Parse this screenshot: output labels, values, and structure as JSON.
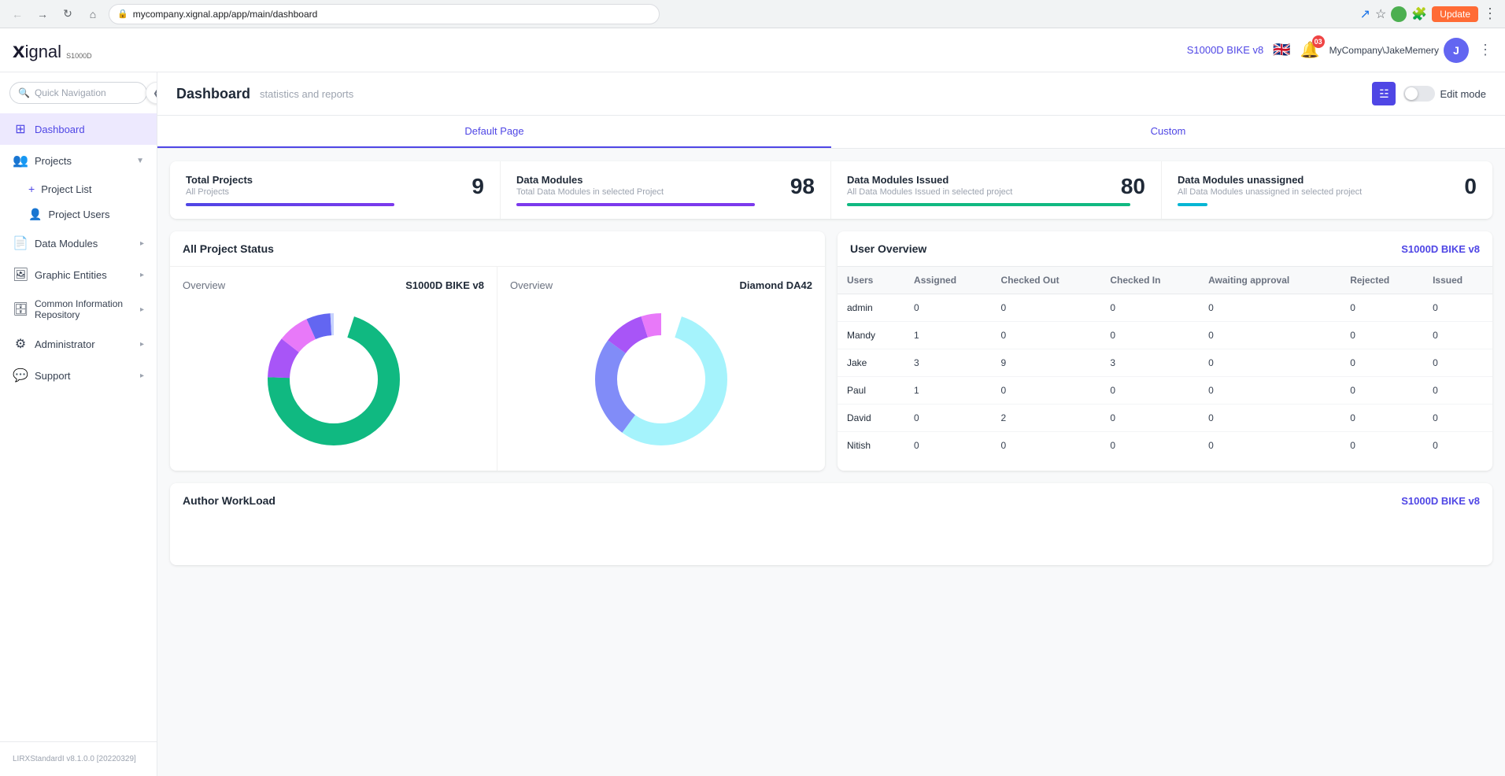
{
  "browser": {
    "url": "mycompany.xignal.app/app/main/dashboard",
    "update_label": "Update"
  },
  "topbar": {
    "logo_x": "x",
    "logo_ignal": "ignal",
    "logo_s1000d": "S1000D",
    "project_label": "S1000D BIKE v8",
    "notification_count": "03",
    "user_company": "MyCompany",
    "user_name": "JakeMemery",
    "user_initial": "J"
  },
  "sidebar": {
    "search_placeholder": "Quick Navigation",
    "items": [
      {
        "id": "dashboard",
        "label": "Dashboard",
        "icon": "⊞",
        "active": true
      },
      {
        "id": "projects",
        "label": "Projects",
        "icon": "📁",
        "has_children": true,
        "expanded": true
      },
      {
        "id": "data-modules",
        "label": "Data Modules",
        "icon": "📄",
        "has_children": true
      },
      {
        "id": "graphic-entities",
        "label": "Graphic Entities",
        "icon": "🖼",
        "has_children": true
      },
      {
        "id": "common-info",
        "label": "Common Information Repository",
        "icon": "🗄",
        "has_children": true
      },
      {
        "id": "administrator",
        "label": "Administrator",
        "icon": "⚙",
        "has_children": true
      },
      {
        "id": "support",
        "label": "Support",
        "icon": "💬",
        "has_children": true
      }
    ],
    "project_children": [
      {
        "id": "project-list",
        "label": "Project List"
      },
      {
        "id": "project-users",
        "label": "Project Users"
      }
    ],
    "version": "LIRXStandardI v8.1.0.0 [20220329]"
  },
  "page": {
    "title": "Dashboard",
    "subtitle": "statistics and reports",
    "edit_mode_label": "Edit mode"
  },
  "tabs": [
    {
      "id": "default-page",
      "label": "Default Page",
      "active": true
    },
    {
      "id": "custom",
      "label": "Custom"
    }
  ],
  "stats": [
    {
      "label": "Total Projects",
      "sublabel": "All Projects",
      "value": "9",
      "bar_color": "blue"
    },
    {
      "label": "Data Modules",
      "sublabel": "Total Data Modules in selected Project",
      "value": "98",
      "bar_color": "purple"
    },
    {
      "label": "Data Modules Issued",
      "sublabel": "All Data Modules Issued in selected project",
      "value": "80",
      "bar_color": "green"
    },
    {
      "label": "Data Modules unassigned",
      "sublabel": "All Data Modules unassigned in selected project",
      "value": "0",
      "bar_color": "cyan"
    }
  ],
  "all_project_status": {
    "title": "All Project Status",
    "charts": [
      {
        "id": "chart1",
        "label": "Overview",
        "project": "S1000D BIKE v8",
        "segments": [
          {
            "color": "#10b981",
            "pct": 72,
            "offset": 0
          },
          {
            "color": "#a855f7",
            "pct": 10,
            "offset": 72
          },
          {
            "color": "#e879f9",
            "pct": 8,
            "offset": 82
          },
          {
            "color": "#6366f1",
            "pct": 6,
            "offset": 90
          },
          {
            "color": "#c7d2fe",
            "pct": 4,
            "offset": 96
          }
        ]
      },
      {
        "id": "chart2",
        "label": "Overview",
        "project": "Diamond DA42",
        "segments": [
          {
            "color": "#a5f3fc",
            "pct": 55,
            "offset": 0
          },
          {
            "color": "#818cf8",
            "pct": 25,
            "offset": 55
          },
          {
            "color": "#a855f7",
            "pct": 10,
            "offset": 80
          },
          {
            "color": "#e879f9",
            "pct": 5,
            "offset": 90
          },
          {
            "color": "#c4b5fd",
            "pct": 5,
            "offset": 95
          }
        ]
      }
    ]
  },
  "user_overview": {
    "title": "User Overview",
    "project": "S1000D BIKE v8",
    "columns": [
      "Users",
      "Assigned",
      "Checked Out",
      "Checked In",
      "Awaiting approval",
      "Rejected",
      "Issued"
    ],
    "rows": [
      {
        "user": "admin",
        "assigned": 0,
        "checked_out": 0,
        "checked_in": 0,
        "awaiting": 0,
        "rejected": 0,
        "issued": 0
      },
      {
        "user": "Mandy",
        "assigned": 1,
        "checked_out": 0,
        "checked_in": 0,
        "awaiting": 0,
        "rejected": 0,
        "issued": 0
      },
      {
        "user": "Jake",
        "assigned": 3,
        "checked_out": 9,
        "checked_in": 3,
        "awaiting": 0,
        "rejected": 0,
        "issued": 0
      },
      {
        "user": "Paul",
        "assigned": 1,
        "checked_out": 0,
        "checked_in": 0,
        "awaiting": 0,
        "rejected": 0,
        "issued": 0
      },
      {
        "user": "David",
        "assigned": 0,
        "checked_out": 2,
        "checked_in": 0,
        "awaiting": 0,
        "rejected": 0,
        "issued": 0
      },
      {
        "user": "Nitish",
        "assigned": 0,
        "checked_out": 0,
        "checked_in": 0,
        "awaiting": 0,
        "rejected": 0,
        "issued": 0
      }
    ]
  },
  "author_workload": {
    "title": "Author WorkLoad",
    "project": "S1000D BIKE v8"
  }
}
